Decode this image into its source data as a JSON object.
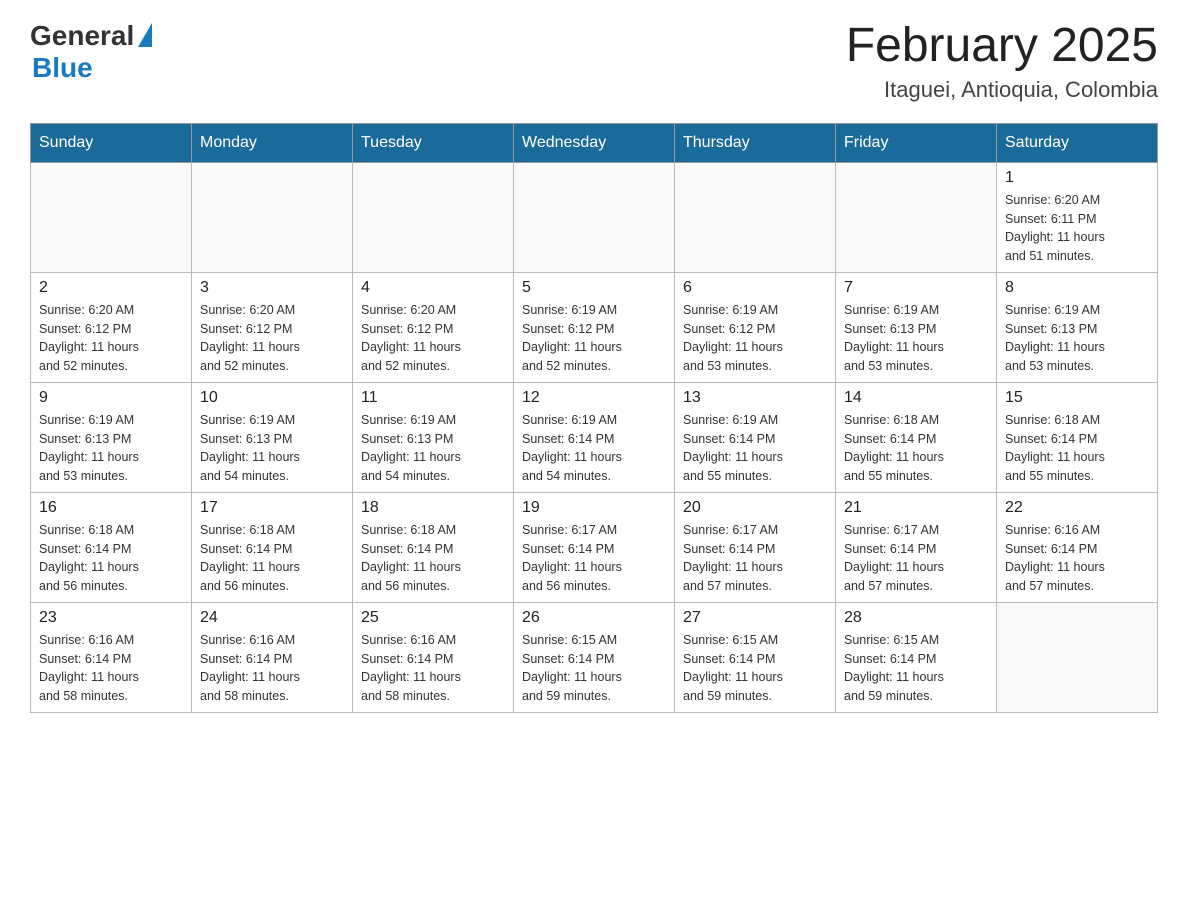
{
  "header": {
    "logo_general": "General",
    "logo_blue": "Blue",
    "month_title": "February 2025",
    "subtitle": "Itaguei, Antioquia, Colombia"
  },
  "weekdays": [
    "Sunday",
    "Monday",
    "Tuesday",
    "Wednesday",
    "Thursday",
    "Friday",
    "Saturday"
  ],
  "weeks": [
    [
      {
        "day": "",
        "info": ""
      },
      {
        "day": "",
        "info": ""
      },
      {
        "day": "",
        "info": ""
      },
      {
        "day": "",
        "info": ""
      },
      {
        "day": "",
        "info": ""
      },
      {
        "day": "",
        "info": ""
      },
      {
        "day": "1",
        "info": "Sunrise: 6:20 AM\nSunset: 6:11 PM\nDaylight: 11 hours\nand 51 minutes."
      }
    ],
    [
      {
        "day": "2",
        "info": "Sunrise: 6:20 AM\nSunset: 6:12 PM\nDaylight: 11 hours\nand 52 minutes."
      },
      {
        "day": "3",
        "info": "Sunrise: 6:20 AM\nSunset: 6:12 PM\nDaylight: 11 hours\nand 52 minutes."
      },
      {
        "day": "4",
        "info": "Sunrise: 6:20 AM\nSunset: 6:12 PM\nDaylight: 11 hours\nand 52 minutes."
      },
      {
        "day": "5",
        "info": "Sunrise: 6:19 AM\nSunset: 6:12 PM\nDaylight: 11 hours\nand 52 minutes."
      },
      {
        "day": "6",
        "info": "Sunrise: 6:19 AM\nSunset: 6:12 PM\nDaylight: 11 hours\nand 53 minutes."
      },
      {
        "day": "7",
        "info": "Sunrise: 6:19 AM\nSunset: 6:13 PM\nDaylight: 11 hours\nand 53 minutes."
      },
      {
        "day": "8",
        "info": "Sunrise: 6:19 AM\nSunset: 6:13 PM\nDaylight: 11 hours\nand 53 minutes."
      }
    ],
    [
      {
        "day": "9",
        "info": "Sunrise: 6:19 AM\nSunset: 6:13 PM\nDaylight: 11 hours\nand 53 minutes."
      },
      {
        "day": "10",
        "info": "Sunrise: 6:19 AM\nSunset: 6:13 PM\nDaylight: 11 hours\nand 54 minutes."
      },
      {
        "day": "11",
        "info": "Sunrise: 6:19 AM\nSunset: 6:13 PM\nDaylight: 11 hours\nand 54 minutes."
      },
      {
        "day": "12",
        "info": "Sunrise: 6:19 AM\nSunset: 6:14 PM\nDaylight: 11 hours\nand 54 minutes."
      },
      {
        "day": "13",
        "info": "Sunrise: 6:19 AM\nSunset: 6:14 PM\nDaylight: 11 hours\nand 55 minutes."
      },
      {
        "day": "14",
        "info": "Sunrise: 6:18 AM\nSunset: 6:14 PM\nDaylight: 11 hours\nand 55 minutes."
      },
      {
        "day": "15",
        "info": "Sunrise: 6:18 AM\nSunset: 6:14 PM\nDaylight: 11 hours\nand 55 minutes."
      }
    ],
    [
      {
        "day": "16",
        "info": "Sunrise: 6:18 AM\nSunset: 6:14 PM\nDaylight: 11 hours\nand 56 minutes."
      },
      {
        "day": "17",
        "info": "Sunrise: 6:18 AM\nSunset: 6:14 PM\nDaylight: 11 hours\nand 56 minutes."
      },
      {
        "day": "18",
        "info": "Sunrise: 6:18 AM\nSunset: 6:14 PM\nDaylight: 11 hours\nand 56 minutes."
      },
      {
        "day": "19",
        "info": "Sunrise: 6:17 AM\nSunset: 6:14 PM\nDaylight: 11 hours\nand 56 minutes."
      },
      {
        "day": "20",
        "info": "Sunrise: 6:17 AM\nSunset: 6:14 PM\nDaylight: 11 hours\nand 57 minutes."
      },
      {
        "day": "21",
        "info": "Sunrise: 6:17 AM\nSunset: 6:14 PM\nDaylight: 11 hours\nand 57 minutes."
      },
      {
        "day": "22",
        "info": "Sunrise: 6:16 AM\nSunset: 6:14 PM\nDaylight: 11 hours\nand 57 minutes."
      }
    ],
    [
      {
        "day": "23",
        "info": "Sunrise: 6:16 AM\nSunset: 6:14 PM\nDaylight: 11 hours\nand 58 minutes."
      },
      {
        "day": "24",
        "info": "Sunrise: 6:16 AM\nSunset: 6:14 PM\nDaylight: 11 hours\nand 58 minutes."
      },
      {
        "day": "25",
        "info": "Sunrise: 6:16 AM\nSunset: 6:14 PM\nDaylight: 11 hours\nand 58 minutes."
      },
      {
        "day": "26",
        "info": "Sunrise: 6:15 AM\nSunset: 6:14 PM\nDaylight: 11 hours\nand 59 minutes."
      },
      {
        "day": "27",
        "info": "Sunrise: 6:15 AM\nSunset: 6:14 PM\nDaylight: 11 hours\nand 59 minutes."
      },
      {
        "day": "28",
        "info": "Sunrise: 6:15 AM\nSunset: 6:14 PM\nDaylight: 11 hours\nand 59 minutes."
      },
      {
        "day": "",
        "info": ""
      }
    ]
  ]
}
